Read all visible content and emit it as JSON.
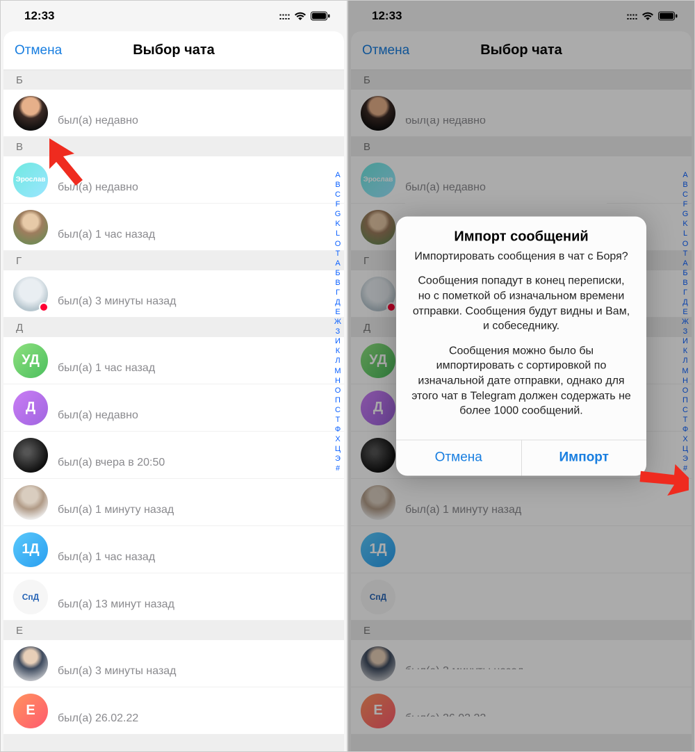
{
  "status": {
    "time": "12:33"
  },
  "nav": {
    "cancel": "Отмена",
    "title": "Выбор чата"
  },
  "dialog": {
    "title": "Импорт сообщений",
    "p1": "Импортировать сообщения в чат с Боря?",
    "p2": "Сообщения попадут в конец переписки, но с пометкой об изначальном времени отправки. Сообщения будут видны и Вам, и собеседнику.",
    "p3": "Сообщения можно было бы импортировать с сортировкой по изначальной дате отправки, однако для этого чат в Telegram должен содержать не более 1000 сообщений.",
    "cancel": "Отмена",
    "confirm": "Импорт"
  },
  "sections": {
    "b": "Б",
    "v": "В",
    "g": "Г",
    "d": "Д",
    "e": "Е"
  },
  "statuses": {
    "recently": "был(а) недавно",
    "h1": "был(а) 1 час назад",
    "m3": "был(а) 3 минуты назад",
    "m1": "был(а) 1 минуту назад",
    "yesterday": "был(а) вчера в 20:50",
    "m13": "был(а) 13 минут назад",
    "date": "был(а) 26.02.22"
  },
  "avatars": {
    "ud": "УД",
    "d": "Д",
    "one_d": "1Д",
    "e": "Е",
    "eroslav": "Эрослав"
  },
  "index_letters": [
    "A",
    "B",
    "C",
    "F",
    "G",
    "K",
    "L",
    "O",
    "T",
    "A",
    "Б",
    "В",
    "Г",
    "Д",
    "Е",
    "Ж",
    "З",
    "И",
    "К",
    "Л",
    "М",
    "Н",
    "О",
    "П",
    "С",
    "Т",
    "Ф",
    "Х",
    "Ц",
    "Э",
    "#"
  ]
}
